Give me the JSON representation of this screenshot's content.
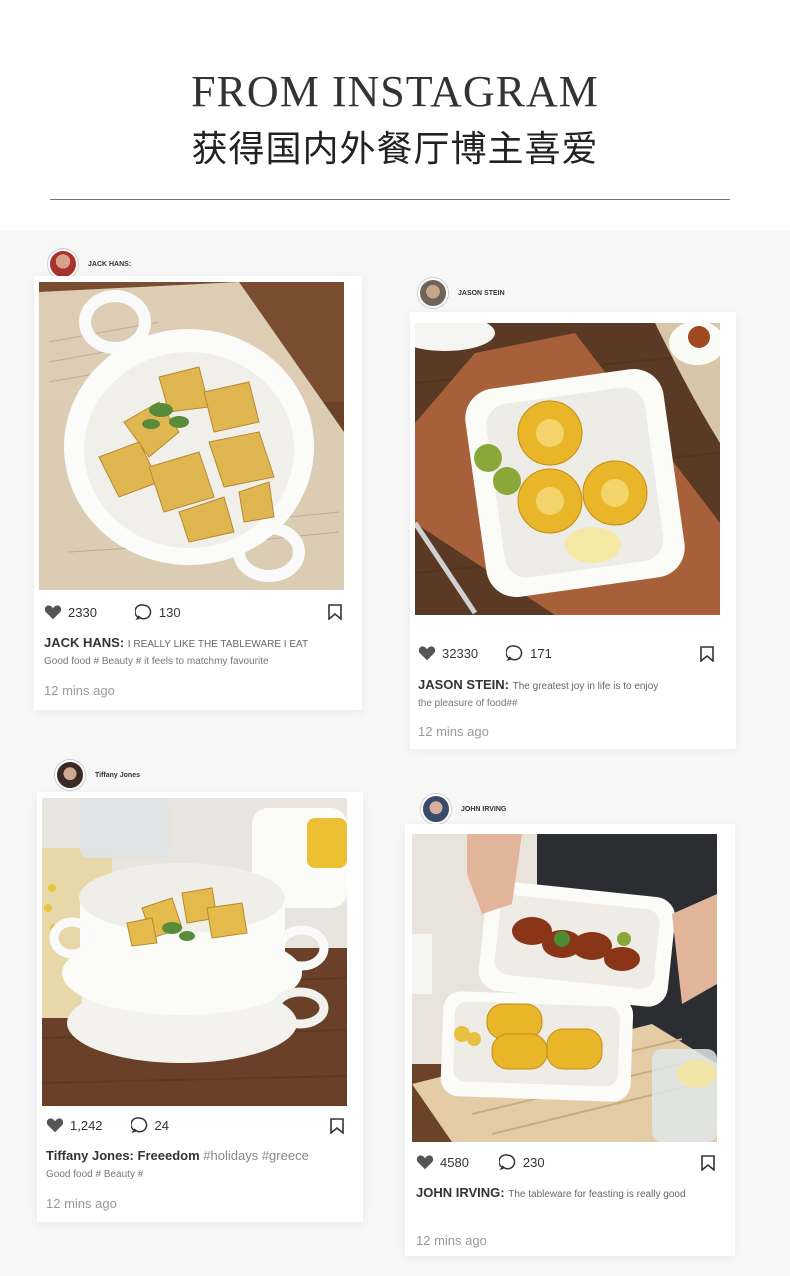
{
  "header": {
    "title_en": "FROM INSTAGRAM",
    "title_cn": "获得国内外餐厅博主喜爱"
  },
  "posts": [
    {
      "username": "JACK HANS:",
      "likes": "2330",
      "comments": "130",
      "caption_name": "JACK HANS:",
      "caption_text": "I REALLY LIKE THE TABLEWARE I EAT",
      "tags": "Good food # Beauty #   it feels to matchmy favourite",
      "time": "12 mins ago",
      "photo": "potato-wedges-in-white-bowl"
    },
    {
      "username": "JASON STEIN",
      "likes": "32330",
      "comments": "171",
      "caption_name": "JASON STEIN:",
      "caption_text": "The greatest joy in life is to enjoy",
      "tags": "the pleasure of food##",
      "time": "12 mins ago",
      "photo": "corn-in-white-baking-dish"
    },
    {
      "username": "Tiffany Jones",
      "likes": "1,242",
      "comments": "24",
      "caption_name": "Tiffany Jones:",
      "caption_text": "Freeedom",
      "caption_tags_inline": "#holidays #greece",
      "tags": "Good food # Beauty #",
      "time": "12 mins ago",
      "photo": "stacked-white-bowls"
    },
    {
      "username": "JOHN IRVING",
      "likes": "4580",
      "comments": "230",
      "caption_name": "JOHN IRVING:",
      "caption_text": "The tableware for feasting is really good",
      "tags": "",
      "time": "12 mins ago",
      "photo": "chicken-wings-and-corn-dishes"
    }
  ],
  "colors": {
    "background": "#f7f7f7",
    "card": "#ffffff",
    "text": "#333333",
    "muted": "#999999"
  }
}
